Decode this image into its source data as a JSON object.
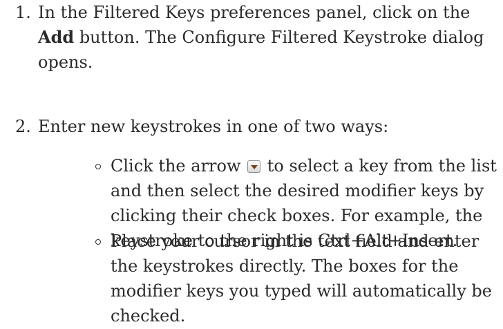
{
  "steps": [
    {
      "number": "1.",
      "text_before": "In the Filtered Keys preferences panel, click on the ",
      "bold": "Add",
      "text_after": " button. The Configure Filtered Keystroke dialog opens."
    },
    {
      "number": "2.",
      "text": "Enter new keystrokes in one of two ways:"
    }
  ],
  "subitems": [
    {
      "text_before": "Click the arrow ",
      "icon": "dropdown-arrow-icon",
      "text_after": " to select a key from the list and then select the desired modifier keys by clicking their check boxes. For example, the keystroke to the right is Ctrl+Alt+Insert."
    },
    {
      "text": "Place your cursor in the text field and enter the keystrokes directly. The boxes for the modifier keys you typed will automatically be checked."
    }
  ]
}
